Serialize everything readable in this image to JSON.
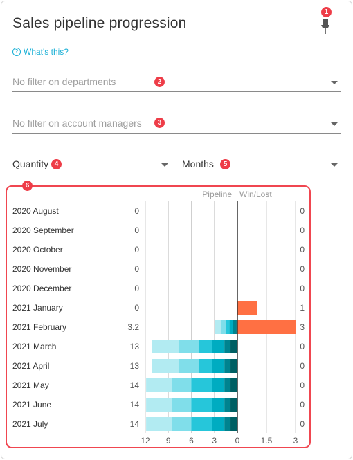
{
  "header": {
    "title": "Sales pipeline progression",
    "help_link": "What's this?",
    "pin_icon": "pushpin-icon"
  },
  "filters": {
    "departments": {
      "placeholder": "No filter on departments",
      "value": ""
    },
    "account_managers": {
      "placeholder": "No filter on account managers",
      "value": ""
    },
    "measure": {
      "value": "Quantity"
    },
    "period": {
      "value": "Months"
    }
  },
  "badges": [
    "1",
    "2",
    "3",
    "4",
    "5",
    "6"
  ],
  "colors": {
    "accent": "#1ab0d6",
    "badge": "#ee3d48",
    "win": "#ff7043",
    "pipeline_segments": [
      "#005f63",
      "#00838f",
      "#00acc1",
      "#26c6da",
      "#80deea",
      "#b2ebf2"
    ]
  },
  "chart_data": {
    "type": "bar",
    "pipeline_header": "Pipeline",
    "winlost_header": "Win/Lost",
    "pipeline_ticks": [
      "12",
      "9",
      "6",
      "3",
      "0"
    ],
    "winlost_ticks": [
      "0",
      "1.5",
      "3"
    ],
    "pipeline_xlim": [
      12,
      0
    ],
    "winlost_xlim": [
      0,
      3
    ],
    "grid": true,
    "rows": [
      {
        "label": "2020 August",
        "pipeline_total": "0",
        "segments": [],
        "winlost": 0,
        "winlost_label": "0"
      },
      {
        "label": "2020 September",
        "pipeline_total": "0",
        "segments": [],
        "winlost": 0,
        "winlost_label": "0"
      },
      {
        "label": "2020 October",
        "pipeline_total": "0",
        "segments": [],
        "winlost": 0,
        "winlost_label": "0"
      },
      {
        "label": "2020 November",
        "pipeline_total": "0",
        "segments": [],
        "winlost": 0,
        "winlost_label": "0"
      },
      {
        "label": "2020 December",
        "pipeline_total": "0",
        "segments": [],
        "winlost": 0,
        "winlost_label": "0"
      },
      {
        "label": "2021 January",
        "pipeline_total": "0",
        "segments": [],
        "winlost": 1,
        "winlost_label": "1"
      },
      {
        "label": "2021 February",
        "pipeline_total": "3.2",
        "segments": [
          0.15,
          0.45,
          0.45,
          0.4,
          0.7,
          0.8
        ],
        "winlost": 3,
        "winlost_label": "3"
      },
      {
        "label": "2021 March",
        "pipeline_total": "13",
        "segments": [
          0.9,
          0.8,
          1.6,
          1.7,
          2.6,
          3.5
        ],
        "winlost": 0,
        "winlost_label": "0"
      },
      {
        "label": "2021 April",
        "pipeline_total": "13",
        "segments": [
          0.9,
          0.8,
          1.6,
          1.7,
          2.6,
          3.5
        ],
        "winlost": 0,
        "winlost_label": "0"
      },
      {
        "label": "2021 May",
        "pipeline_total": "14",
        "segments": [
          0.9,
          0.8,
          1.6,
          2.7,
          2.5,
          3.4
        ],
        "winlost": 0,
        "winlost_label": "0"
      },
      {
        "label": "2021 June",
        "pipeline_total": "14",
        "segments": [
          0.9,
          0.8,
          1.6,
          2.7,
          2.5,
          3.4
        ],
        "winlost": 0,
        "winlost_label": "0"
      },
      {
        "label": "2021 July",
        "pipeline_total": "14",
        "segments": [
          0.9,
          0.8,
          1.6,
          2.7,
          2.5,
          3.4
        ],
        "winlost": 0,
        "winlost_label": "0"
      }
    ]
  }
}
